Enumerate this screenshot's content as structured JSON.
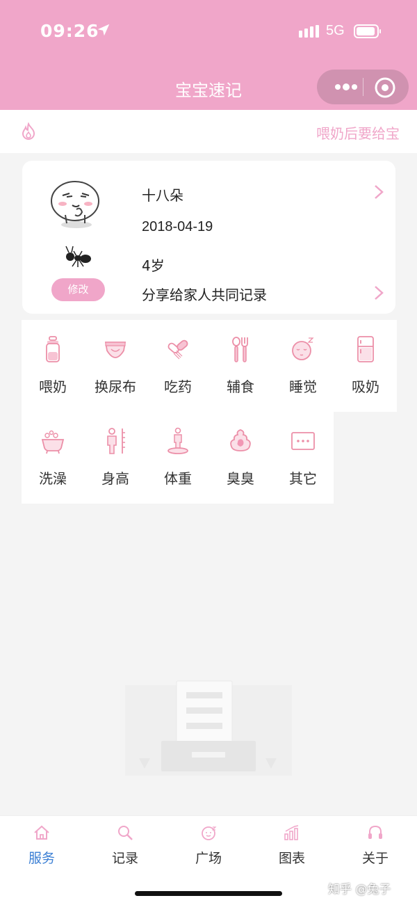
{
  "status_bar": {
    "time": "09:26",
    "network": "5G"
  },
  "header": {
    "title": "宝宝速记"
  },
  "tip": {
    "text": "喂奶后要给宝"
  },
  "profile": {
    "name": "十八朵",
    "birthday": "2018-04-19",
    "age": "4岁",
    "edit_label": "修改",
    "share_label": "分享给家人共同记录"
  },
  "functions": [
    {
      "label": "喂奶",
      "icon": "bottle-icon"
    },
    {
      "label": "换尿布",
      "icon": "diaper-icon"
    },
    {
      "label": "吃药",
      "icon": "pill-icon"
    },
    {
      "label": "辅食",
      "icon": "spoon-fork-icon"
    },
    {
      "label": "睡觉",
      "icon": "sleeping-baby-icon"
    },
    {
      "label": "吸奶",
      "icon": "fridge-icon"
    },
    {
      "label": "洗澡",
      "icon": "bathtub-icon"
    },
    {
      "label": "身高",
      "icon": "height-ruler-icon"
    },
    {
      "label": "体重",
      "icon": "scale-icon"
    },
    {
      "label": "臭臭",
      "icon": "poop-icon"
    },
    {
      "label": "其它",
      "icon": "more-box-icon"
    }
  ],
  "tabs": [
    {
      "label": "服务",
      "icon": "home-icon",
      "active": true
    },
    {
      "label": "记录",
      "icon": "search-icon",
      "active": false
    },
    {
      "label": "广场",
      "icon": "baby-face-icon",
      "active": false
    },
    {
      "label": "图表",
      "icon": "bar-chart-icon",
      "active": false
    },
    {
      "label": "关于",
      "icon": "headset-icon",
      "active": false
    }
  ],
  "watermark": "知乎 @兔子",
  "colors": {
    "primary": "#f0a6c9",
    "tab_active": "#3b7fd4",
    "icon_pink": "#ec8fa8"
  }
}
